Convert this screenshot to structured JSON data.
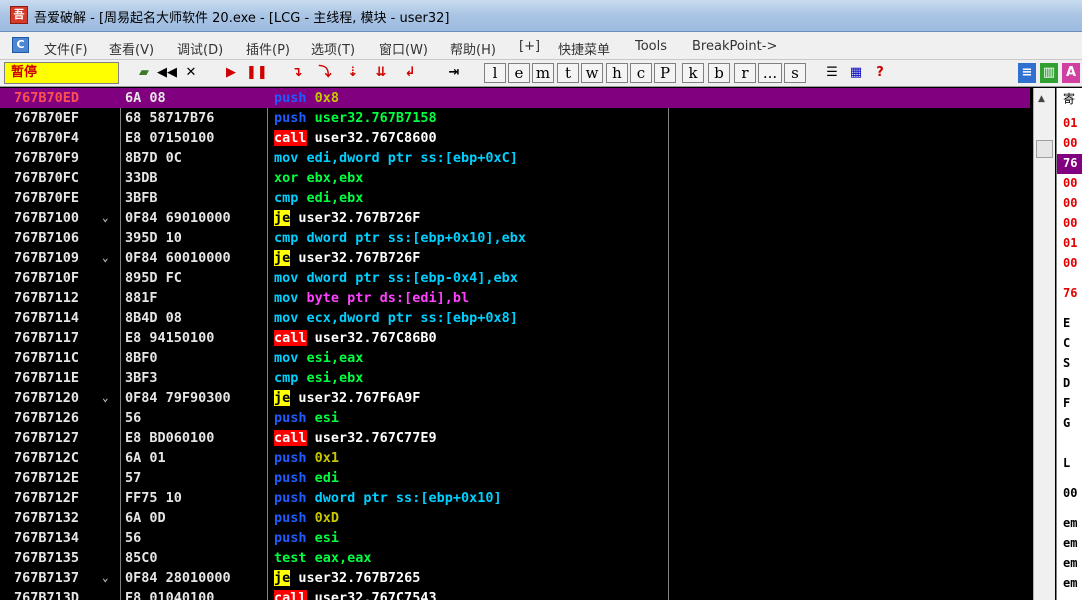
{
  "window": {
    "title": "吾爱破解 - [周易起名大师软件 20.exe - [LCG - 主线程, 模块 - user32]",
    "app_icon": "吾"
  },
  "menu": {
    "mdi_icon": "C",
    "items": [
      "文件(F)",
      "查看(V)",
      "调试(D)",
      "插件(P)",
      "选项(T)",
      "窗口(W)",
      "帮助(H)",
      "[+]",
      "快捷菜单",
      "Tools",
      "BreakPoint->"
    ]
  },
  "toolbar": {
    "status": "暂停",
    "letters": [
      "l",
      "e",
      "m",
      "t",
      "w",
      "h",
      "c",
      "P",
      "k",
      "b",
      "r",
      "...",
      "s"
    ]
  },
  "colors": {
    "highlight": "#800080",
    "push": "#1e5cff",
    "call_bg": "#ff0000",
    "je_bg": "#ffff00",
    "mov": "#00d0ff",
    "xor_test": "#00ff40"
  },
  "disasm": [
    {
      "addr": "767B70ED",
      "hex": "6A 08",
      "mn": "push",
      "op": "0x8",
      "hl": true
    },
    {
      "addr": "767B70EF",
      "hex": "68 58717B76",
      "mn": "push",
      "op": "user32.767B7158"
    },
    {
      "addr": "767B70F4",
      "hex": "E8 07150100",
      "mn": "call",
      "op": "user32.767C8600"
    },
    {
      "addr": "767B70F9",
      "hex": "8B7D 0C",
      "mn": "mov",
      "op": "edi,dword ptr ss:[ebp+0xC]"
    },
    {
      "addr": "767B70FC",
      "hex": "33DB",
      "mn": "xor",
      "op": "ebx,ebx"
    },
    {
      "addr": "767B70FE",
      "hex": "3BFB",
      "mn": "cmp",
      "op": "edi,ebx"
    },
    {
      "addr": "767B7100",
      "hex": "0F84 69010000",
      "mn": "je",
      "op": "user32.767B726F",
      "jump": "⌄"
    },
    {
      "addr": "767B7106",
      "hex": "395D 10",
      "mn": "cmp",
      "op": "dword ptr ss:[ebp+0x10],ebx"
    },
    {
      "addr": "767B7109",
      "hex": "0F84 60010000",
      "mn": "je",
      "op": "user32.767B726F",
      "jump": "⌄"
    },
    {
      "addr": "767B710F",
      "hex": "895D FC",
      "mn": "mov",
      "op": "dword ptr ss:[ebp-0x4],ebx"
    },
    {
      "addr": "767B7112",
      "hex": "881F",
      "mn": "mov",
      "op": "byte ptr ds:[edi],bl"
    },
    {
      "addr": "767B7114",
      "hex": "8B4D 08",
      "mn": "mov",
      "op": "ecx,dword ptr ss:[ebp+0x8]"
    },
    {
      "addr": "767B7117",
      "hex": "E8 94150100",
      "mn": "call",
      "op": "user32.767C86B0"
    },
    {
      "addr": "767B711C",
      "hex": "8BF0",
      "mn": "mov",
      "op": "esi,eax"
    },
    {
      "addr": "767B711E",
      "hex": "3BF3",
      "mn": "cmp",
      "op": "esi,ebx"
    },
    {
      "addr": "767B7120",
      "hex": "0F84 79F90300",
      "mn": "je",
      "op": "user32.767F6A9F",
      "jump": "⌄"
    },
    {
      "addr": "767B7126",
      "hex": "56",
      "mn": "push",
      "op": "esi"
    },
    {
      "addr": "767B7127",
      "hex": "E8 BD060100",
      "mn": "call",
      "op": "user32.767C77E9"
    },
    {
      "addr": "767B712C",
      "hex": "6A 01",
      "mn": "push",
      "op": "0x1"
    },
    {
      "addr": "767B712E",
      "hex": "57",
      "mn": "push",
      "op": "edi"
    },
    {
      "addr": "767B712F",
      "hex": "FF75 10",
      "mn": "push",
      "op": "dword ptr ss:[ebp+0x10]"
    },
    {
      "addr": "767B7132",
      "hex": "6A 0D",
      "mn": "push",
      "op": "0xD"
    },
    {
      "addr": "767B7134",
      "hex": "56",
      "mn": "push",
      "op": "esi"
    },
    {
      "addr": "767B7135",
      "hex": "85C0",
      "mn": "test",
      "op": "eax,eax"
    },
    {
      "addr": "767B7137",
      "hex": "0F84 28010000",
      "mn": "je",
      "op": "user32.767B7265",
      "jump": "⌄"
    },
    {
      "addr": "767B713D",
      "hex": "E8 01040100",
      "mn": "call",
      "op": "user32.767C7543"
    }
  ],
  "registers_pane": {
    "header": "寄",
    "lines": [
      "01",
      "00",
      "76",
      "00",
      "00",
      "00",
      "01",
      "00",
      "76",
      "E",
      "C",
      "S",
      "D",
      "F",
      "G",
      "L",
      "00",
      "em",
      "em",
      "em",
      "em"
    ]
  }
}
